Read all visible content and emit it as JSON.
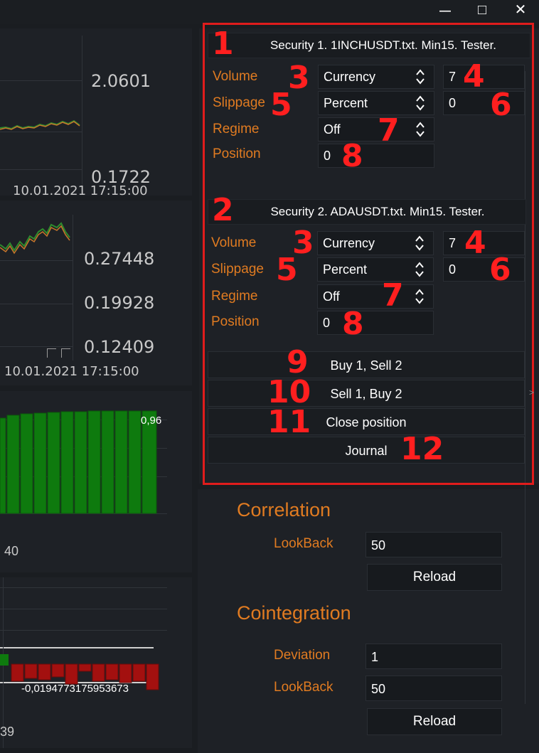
{
  "window": {
    "minimize": "—",
    "maximize": "□",
    "close": "✕"
  },
  "chart1": {
    "price_high": "2.0601",
    "price_low": "0.1722",
    "date": "10.01.2021 17:15:00"
  },
  "chart2": {
    "p1": "0.27448",
    "p2": "0.19928",
    "p3": "0.12409",
    "date": "10.01.2021 17:15:00"
  },
  "chart3": {
    "value_label": "0,96",
    "x_label": "40"
  },
  "chart4": {
    "value_label": "-0,0194773175953673",
    "x_label": "39"
  },
  "security1": {
    "header": "Security 1. 1INCHUSDT.txt. Min15. Tester.",
    "volume_label": "Volume",
    "volume_type": "Currency",
    "volume_value": "7",
    "slippage_label": "Slippage",
    "slippage_type": "Percent",
    "slippage_value": "0",
    "regime_label": "Regime",
    "regime_value": "Off",
    "position_label": "Position",
    "position_value": "0"
  },
  "security2": {
    "header": "Security 2. ADAUSDT.txt. Min15. Tester.",
    "volume_label": "Volume",
    "volume_type": "Currency",
    "volume_value": "7",
    "slippage_label": "Slippage",
    "slippage_type": "Percent",
    "slippage_value": "0",
    "regime_label": "Regime",
    "regime_value": "Off",
    "position_label": "Position",
    "position_value": "0"
  },
  "actions": {
    "buy_sell": "Buy 1, Sell 2",
    "sell_buy": "Sell 1, Buy 2",
    "close": "Close position",
    "journal": "Journal"
  },
  "annotations": {
    "n1": "1",
    "n2": "2",
    "n3": "3",
    "n4": "4",
    "n5": "5",
    "n6": "6",
    "n7": "7",
    "n8": "8",
    "n9": "9",
    "n10": "10",
    "n11": "11",
    "n12": "12"
  },
  "correlation": {
    "title": "Correlation",
    "lookback_label": "LookBack",
    "lookback_value": "50",
    "reload": "Reload"
  },
  "cointegration": {
    "title": "Cointegration",
    "deviation_label": "Deviation",
    "deviation_value": "1",
    "lookback_label": "LookBack",
    "lookback_value": "50",
    "reload": "Reload"
  },
  "colors": {
    "accent": "#e07b21",
    "annotation": "#e01c1c",
    "bar_green": "#0e7a0e",
    "bar_red": "#a3100f"
  }
}
